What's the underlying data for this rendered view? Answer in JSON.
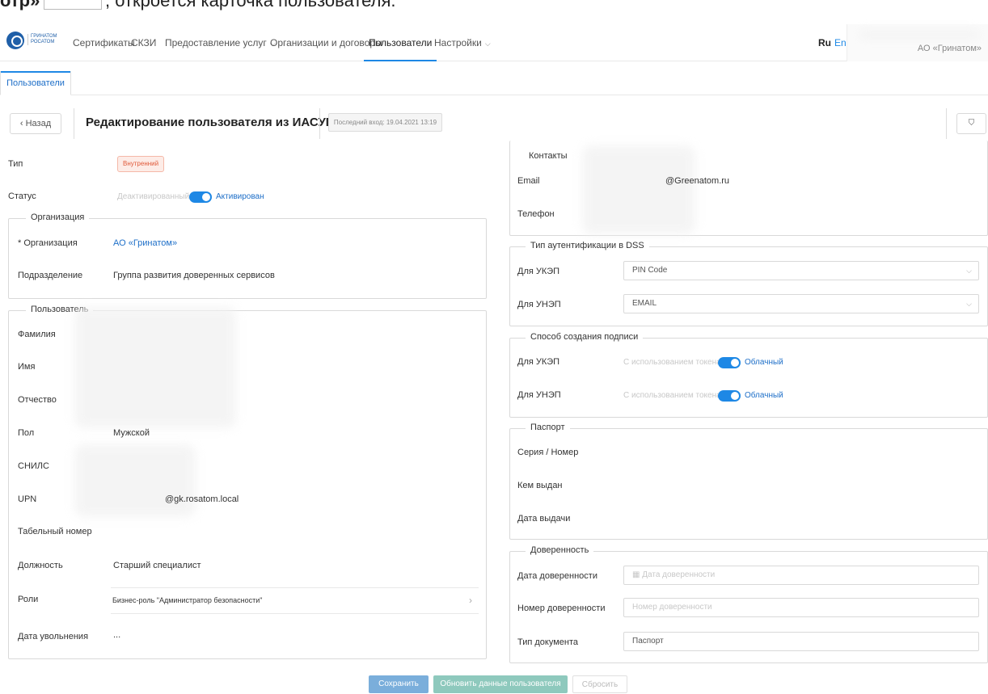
{
  "doc_strip": {
    "bold": "отр»",
    "rest": ", откроется карточка пользователя."
  },
  "logo": {
    "line1": "ГРИНАТОМ",
    "line2": "РОСАТОМ"
  },
  "nav": {
    "items": [
      {
        "label": "Сертификаты"
      },
      {
        "label": "СКЗИ"
      },
      {
        "label": "Предоставление услуг",
        "caret": "⌵"
      },
      {
        "label": "Организации и договоры"
      },
      {
        "label": "Пользователи"
      },
      {
        "label": "Настройки",
        "caret": "⌵"
      }
    ],
    "lang_ru": "Ru",
    "lang_en": "En",
    "user_org": "АО «Гринатом»"
  },
  "tab": {
    "label": "Пользователи"
  },
  "header": {
    "back_label": "‹  Назад",
    "title": "Редактирование пользователя из ИАСУП",
    "last_login": "Последний вход: 19.04.2021 13:19",
    "right_icon": "⛉"
  },
  "left": {
    "type_label": "Тип",
    "type_value": "Внутренний",
    "status_label": "Статус",
    "status_off": "Деактивированный",
    "status_on": "Активирован",
    "org_group": "Организация",
    "org_label": "* Организация",
    "org_value": "АО «Гринатом»",
    "dept_label": "Подразделение",
    "dept_value": "Группа развития доверенных сервисов",
    "user_group": "Пользователь",
    "fields": {
      "last_name": "Фамилия",
      "first_name": "Имя",
      "middle_name": "Отчество",
      "gender": "Пол",
      "gender_value": "Мужской",
      "snils": "СНИЛС",
      "upn": "UPN",
      "upn_value": "@gk.rosatom.local",
      "tab_number": "Табельный номер",
      "position": "Должность",
      "position_value": "Старший специалист",
      "roles": "Роли",
      "roles_value": "Бизнес-роль \"Администратор безопасности\"",
      "roles_arrow": "›",
      "dismissal": "Дата увольнения",
      "dismissal_value": "..."
    }
  },
  "right": {
    "contacts_group": "Контакты",
    "email_label": "Email",
    "email_value": "@Greenatom.ru",
    "phone_label": "Телефон",
    "auth_group": "Тип аутентификации в DSS",
    "ukep_label": "Для УКЭП",
    "ukep_value": "PIN Code",
    "unep_label": "Для УНЭП",
    "unep_value": "EMAIL",
    "sign_group": "Способ создания подписи",
    "sign_ukep_label": "Для УКЭП",
    "sign_unep_label": "Для УНЭП",
    "token_label": "С использованием токена",
    "cloud_label": "Облачный",
    "passport_group": "Паспорт",
    "series_label": "Серия / Номер",
    "issued_by_label": "Кем выдан",
    "issue_date_label": "Дата выдачи",
    "poa_group": "Доверенность",
    "poa_date_label": "Дата доверенности",
    "poa_date_placeholder": "Дата доверенности",
    "poa_number_label": "Номер доверенности",
    "poa_number_placeholder": "Номер доверенности",
    "doc_type_label": "Тип документа",
    "doc_type_value": "Паспорт"
  },
  "actions": {
    "save": "Сохранить",
    "refresh": "Обновить данные пользователя",
    "reset": "Сбросить"
  },
  "colors": {
    "accent": "#1e88e5",
    "tag_red": "#e05a3a",
    "save_btn": "#7aaedb",
    "refresh_btn": "#8ec9bd"
  }
}
